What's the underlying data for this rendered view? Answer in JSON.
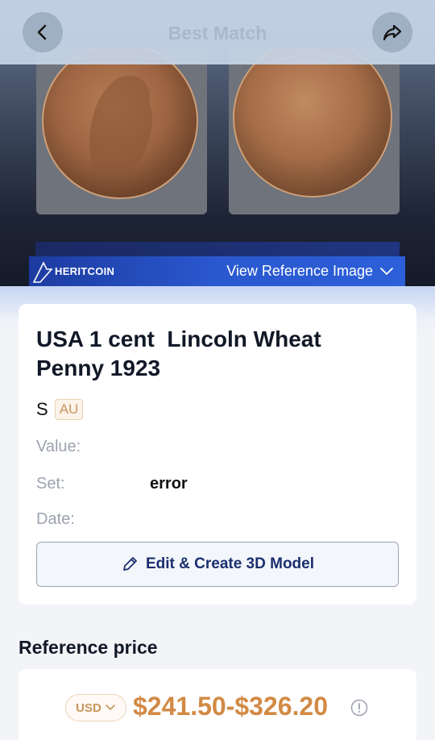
{
  "header": {
    "title": "Best Match"
  },
  "icons": {
    "back": "chevron-left-icon",
    "share": "share-arrow-icon",
    "dropdown": "chevron-down-icon",
    "edit": "pencil-icon",
    "info": "info-circle-icon"
  },
  "reference_banner": {
    "brand": "HERITCOIN",
    "label": "View Reference Image"
  },
  "coin": {
    "title": "USA 1 cent  Lincoln Wheat Penny 1923",
    "mint_mark": "S",
    "grade": "AU",
    "fields": {
      "value_label": "Value:",
      "set_label": "Set:",
      "set_value": "error",
      "date_label": "Date:"
    },
    "edit_button": "Edit & Create 3D Model"
  },
  "reference_price": {
    "title": "Reference price",
    "currency": "USD",
    "range": "$241.50-$326.20"
  },
  "colors": {
    "accent_price": "#d28a45",
    "banner_blue": "#2a58cf",
    "button_text": "#1b2f6e"
  }
}
